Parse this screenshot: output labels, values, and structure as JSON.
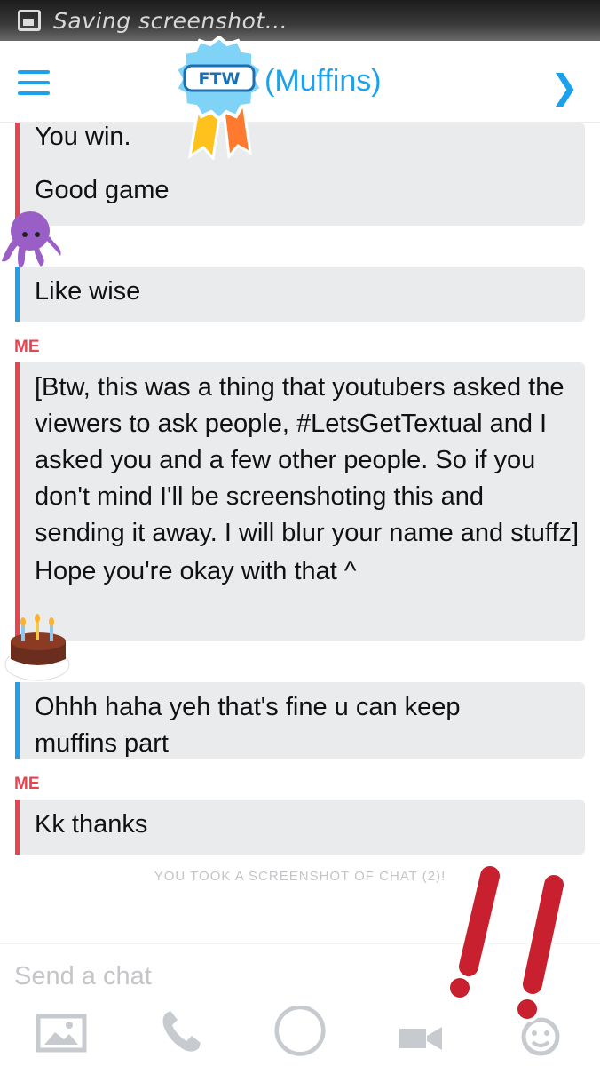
{
  "status": {
    "text": "Saving screenshot..."
  },
  "header": {
    "title": "(Muffins)",
    "badge_text": "FTW"
  },
  "messages": [
    {
      "sender": "",
      "lines": [
        "You win.",
        "Good game"
      ]
    },
    {
      "sender": "",
      "lines": [
        "Like wise"
      ]
    },
    {
      "sender": "ME",
      "lines": [
        "[Btw, this was a thing that youtubers asked the viewers to ask people, #LetsGetTextual and I asked you and a few other people. So if you don't mind I'll be screenshoting this and sending it away. I will blur your name and stuffz]",
        "Hope you're okay with that ^"
      ]
    },
    {
      "sender": "",
      "lines": [
        "Ohhh haha yeh that's fine u can keep muffins part"
      ]
    },
    {
      "sender": "ME",
      "lines": [
        "Kk thanks"
      ]
    }
  ],
  "notice": "YOU TOOK A SCREENSHOT OF CHAT (2)!",
  "input": {
    "placeholder": "Send a chat"
  },
  "colors": {
    "accent_blue": "#1da1ec",
    "accent_red": "#e8434f",
    "bubble": "#e9ebec"
  },
  "icons": [
    "screenshot-icon",
    "menu-icon",
    "chevron-right-icon",
    "gallery-icon",
    "phone-icon",
    "capture-button-icon",
    "video-icon",
    "smiley-icon"
  ]
}
